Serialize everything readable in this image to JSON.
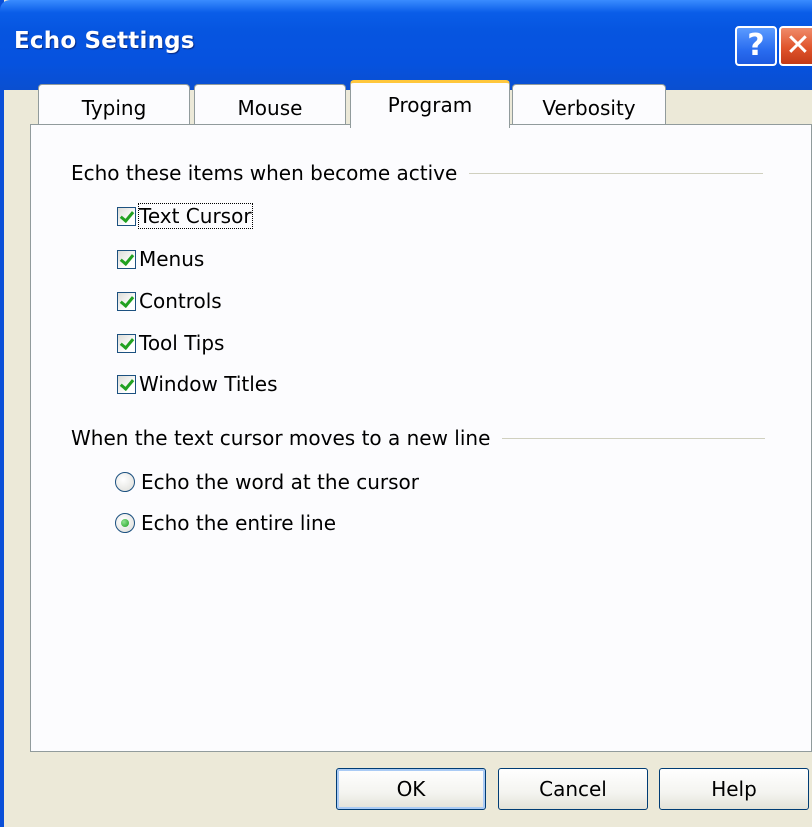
{
  "window": {
    "title": "Echo Settings",
    "help_label": "?",
    "close_label": "✕"
  },
  "tabs": [
    {
      "label": "Typing",
      "active": false
    },
    {
      "label": "Mouse",
      "active": false
    },
    {
      "label": "Program",
      "active": true
    },
    {
      "label": "Verbosity",
      "active": false
    }
  ],
  "group1": {
    "label": "Echo these items when become active",
    "items": [
      {
        "label": "Text Cursor",
        "checked": true
      },
      {
        "label": "Menus",
        "checked": true
      },
      {
        "label": "Controls",
        "checked": true
      },
      {
        "label": "Tool Tips",
        "checked": true
      },
      {
        "label": "Window Titles",
        "checked": true
      }
    ]
  },
  "group2": {
    "label": "When the text cursor moves to a new line",
    "options": [
      {
        "label": "Echo the word at the cursor",
        "selected": false
      },
      {
        "label": "Echo the entire line",
        "selected": true
      }
    ]
  },
  "buttons": {
    "ok": "OK",
    "cancel": "Cancel",
    "help": "Help"
  },
  "colors": {
    "titlebar": "#0655e0",
    "check": "#21a121",
    "active_tab_accent": "#ffc73c"
  }
}
